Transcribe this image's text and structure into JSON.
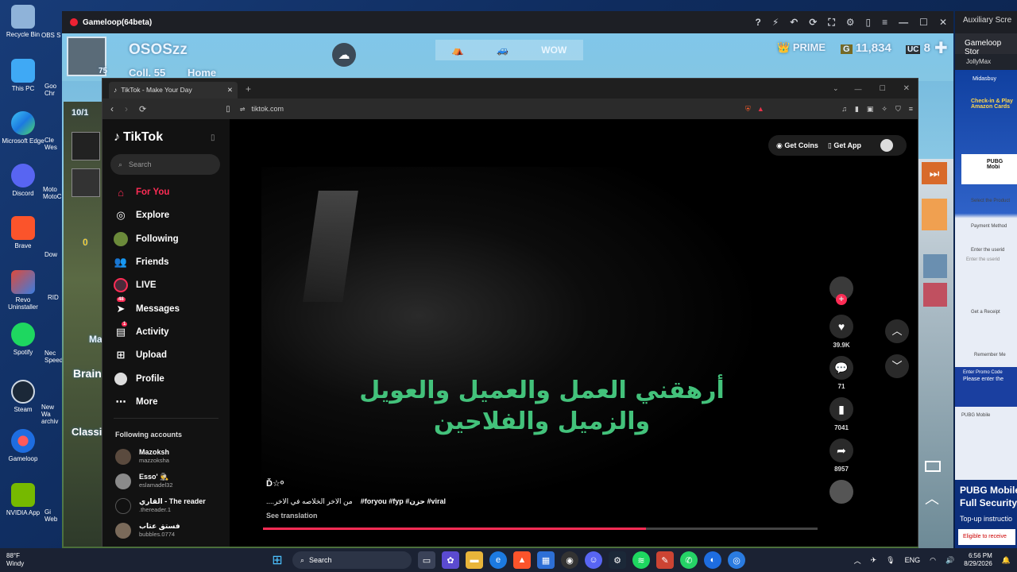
{
  "desktop": {
    "icons": [
      "Recycle Bin",
      "This PC",
      "Microsoft Edge",
      "Discord",
      "Brave",
      "Revo Uninstaller",
      "Spotify",
      "Steam",
      "Gameloop",
      "NVIDIA App"
    ],
    "partial_icons": [
      "OBS S",
      "Goo Chr",
      "Cle Wes",
      "Moto MotoC",
      "Dow",
      "RID",
      "Nec Speed",
      "New Wa archiv",
      "Gi Web"
    ]
  },
  "gameloop": {
    "title": "Gameloop(64beta)",
    "player_name": "OSOSzz",
    "level": "75",
    "hud_texts": [
      "Coll. 55",
      "Home"
    ],
    "mode_label": "WOW",
    "prime_label": "PRIME",
    "g_coins": "11,834",
    "uc_badge": "UC",
    "uc_value": "8",
    "left_panel_texts": [
      "10/1",
      "0",
      "Ma",
      "Brain",
      "Classic"
    ]
  },
  "aux": {
    "title": "Auxiliary Scre",
    "store": "Gameloop Stor",
    "jolly": "JollyMax",
    "items": [
      "Midasbuy",
      "Check-in & Play Amazon Cards",
      "PUBG Mobi",
      "Select the Product",
      "Payment Method",
      "Enter the userid",
      "Enter the userid",
      "Get a Receipt",
      "Remember Me",
      "Enter Promo Code",
      "Please enter the",
      "PUBG Mobile",
      "PUBG Mobile",
      "Full Security,",
      "Top-up instructio",
      "Eligible to receive"
    ]
  },
  "browser": {
    "tab_title": "TikTok - Make Your Day",
    "url": "tiktok.com"
  },
  "tiktok": {
    "logo": "TikTok",
    "search_placeholder": "Search",
    "nav": [
      "For You",
      "Explore",
      "Following",
      "Friends",
      "LIVE",
      "Messages",
      "Activity",
      "Upload",
      "Profile",
      "More"
    ],
    "messages_badge": "48",
    "activity_badge": "1",
    "following_header": "Following accounts",
    "accounts": [
      {
        "name": "Mazoksh",
        "handle": "mazzoksha"
      },
      {
        "name": "Esso' 🕵",
        "handle": "eslamadel32"
      },
      {
        "name": "القاري - The reader",
        "handle": ".thereader.1"
      },
      {
        "name": "فستق عتاب",
        "handle": "bubbles.0774"
      }
    ],
    "get_coins": "Get Coins",
    "get_app": "Get App",
    "video": {
      "caption_ar_line1": "أرهقني العمل والعميل والعويل",
      "caption_ar_line2": "والزميل والفلاحين",
      "author": "Ď☆ᵒ",
      "desc": "من الاخر الخلاصه في الاخر....",
      "hashtags": "#foryou #fyp #حزن #viral",
      "see_translation": "See translation",
      "progress": 0.69
    },
    "rail": {
      "likes": "39.9K",
      "comments": "71",
      "saves": "7041",
      "shares": "8957"
    }
  },
  "taskbar": {
    "weather_temp": "88°F",
    "weather_desc": "Windy",
    "search": "Search",
    "lang": "ENG",
    "time": "6:56 PM",
    "date": "8/29/2026"
  }
}
